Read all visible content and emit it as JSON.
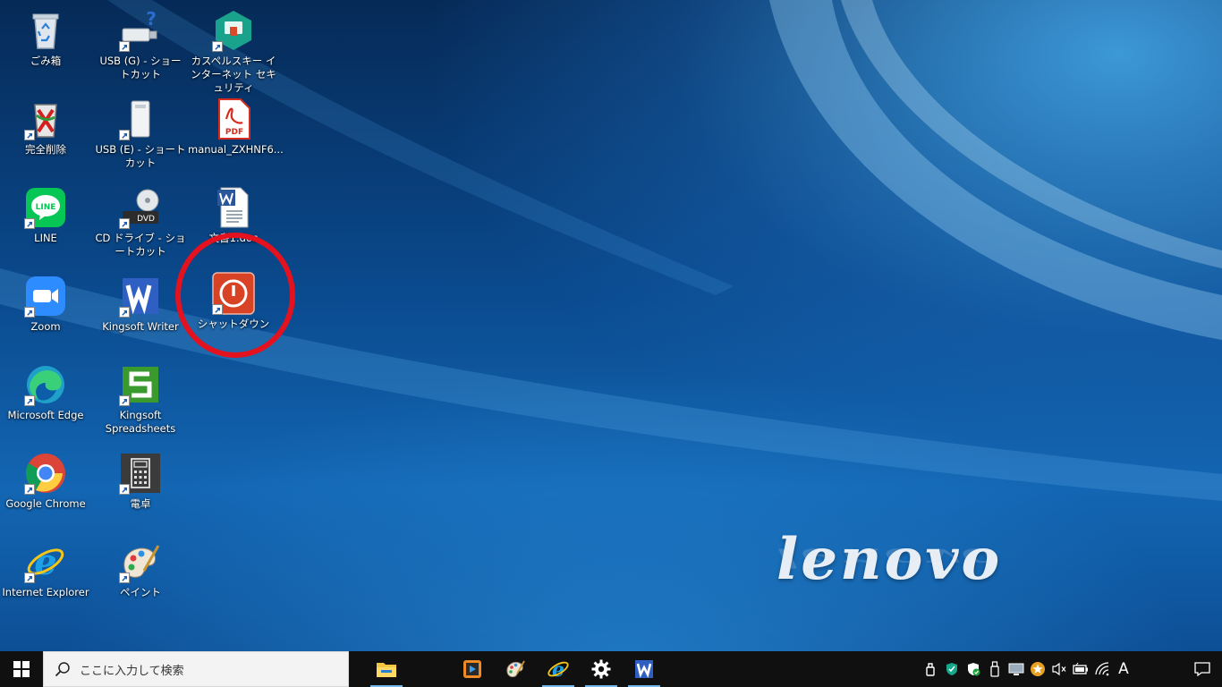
{
  "desktop": {
    "icons": [
      {
        "label": "ごみ箱",
        "icon": "recycle-bin-icon"
      },
      {
        "label": "完全削除",
        "icon": "complete-delete-icon"
      },
      {
        "label": "LINE",
        "icon": "line-icon"
      },
      {
        "label": "Zoom",
        "icon": "zoom-icon"
      },
      {
        "label": "Microsoft Edge",
        "icon": "edge-icon"
      },
      {
        "label": "Google Chrome",
        "icon": "chrome-icon"
      },
      {
        "label": "Internet Explorer",
        "icon": "internet-explorer-icon"
      },
      {
        "label": "USB (G) - ショートカット",
        "icon": "usb-drive-icon"
      },
      {
        "label": "USB (E) - ショートカット",
        "icon": "usb-drive-icon"
      },
      {
        "label": "CD ドライブ - ショートカット",
        "icon": "dvd-drive-icon"
      },
      {
        "label": "Kingsoft Writer",
        "icon": "kingsoft-writer-icon"
      },
      {
        "label": "Kingsoft Spreadsheets",
        "icon": "kingsoft-spreadsheets-icon"
      },
      {
        "label": "電卓",
        "icon": "calculator-icon"
      },
      {
        "label": "ペイント",
        "icon": "paint-icon"
      },
      {
        "label": "カスペルスキー インターネット セキュリティ",
        "icon": "kaspersky-icon"
      },
      {
        "label": "manual_ZXHNF6...",
        "icon": "pdf-icon"
      },
      {
        "label": "文書1.doc",
        "icon": "word-document-icon"
      },
      {
        "label": "シャットダウン",
        "icon": "shutdown-icon"
      }
    ],
    "wallpaper_brand": "lenovo",
    "annotation_color": "#e3121e"
  },
  "taskbar": {
    "search_placeholder": "ここに入力して検索",
    "pinned_apps": [
      {
        "name": "file-explorer-icon",
        "running": true
      },
      {
        "name": "media-player-icon",
        "running": false
      },
      {
        "name": "paint-icon",
        "running": false
      },
      {
        "name": "internet-explorer-icon",
        "running": true
      },
      {
        "name": "settings-gear-icon",
        "running": true
      },
      {
        "name": "kingsoft-writer-icon",
        "running": true
      }
    ],
    "tray": {
      "ime_mode": "A",
      "icons": [
        "usb-eject-icon",
        "security-shield-icon",
        "defender-icon",
        "usb-device-icon",
        "display-icon",
        "star-badge-icon",
        "volume-muted-icon",
        "battery-icon",
        "wifi-icon"
      ]
    }
  },
  "colors": {
    "taskbar_bg": "#101010",
    "search_bg": "#f3f3f3",
    "accent": "#76b9ed"
  }
}
